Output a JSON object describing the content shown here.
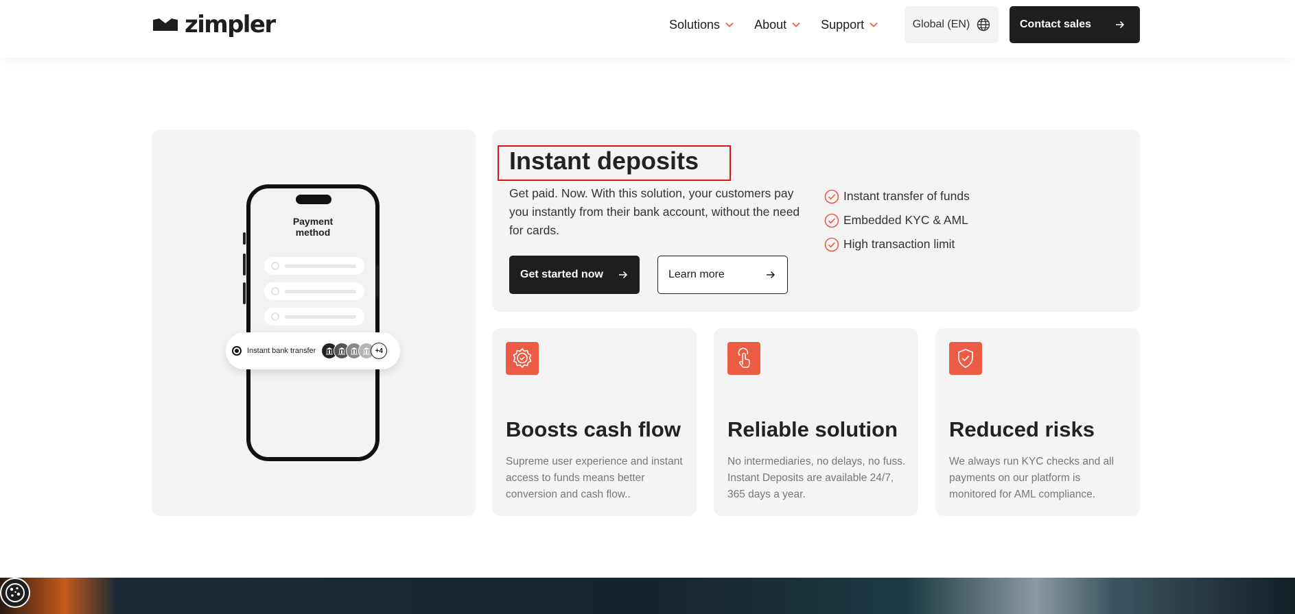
{
  "header": {
    "logo_text": "zimpler",
    "nav": [
      {
        "label": "Solutions"
      },
      {
        "label": "About"
      },
      {
        "label": "Support"
      }
    ],
    "language_label": "Global (EN)",
    "contact_label": "Contact sales"
  },
  "phone": {
    "title_line1": "Payment",
    "title_line2": "method",
    "selected_option": "Instant bank transfer",
    "more_banks": "+4"
  },
  "hero": {
    "title": "Instant deposits",
    "description": "Get paid. Now. With this solution, your customers pay you instantly from their bank account, without the need for cards.",
    "primary_button": "Get started now",
    "secondary_button": "Learn more",
    "features": [
      "Instant transfer of funds",
      "Embedded KYC & AML",
      "High transaction limit"
    ]
  },
  "benefits": [
    {
      "title": "Boosts cash flow",
      "text": "Supreme user experience and instant access to funds means better conversion and cash flow..",
      "icon": "gear-check-icon"
    },
    {
      "title": "Reliable solution",
      "text": "No intermediaries, no delays, no fuss. Instant Deposits are available 24/7, 365 days a year.",
      "icon": "tap-hand-icon"
    },
    {
      "title": "Reduced risks",
      "text": "We always run KYC checks and all payments on our platform is monitored for AML compliance.",
      "icon": "shield-check-icon"
    }
  ],
  "colors": {
    "accent": "#ec5b45",
    "dark": "#1e1e1e",
    "card_bg": "#f4f4f4",
    "highlight": "#e2101a"
  }
}
